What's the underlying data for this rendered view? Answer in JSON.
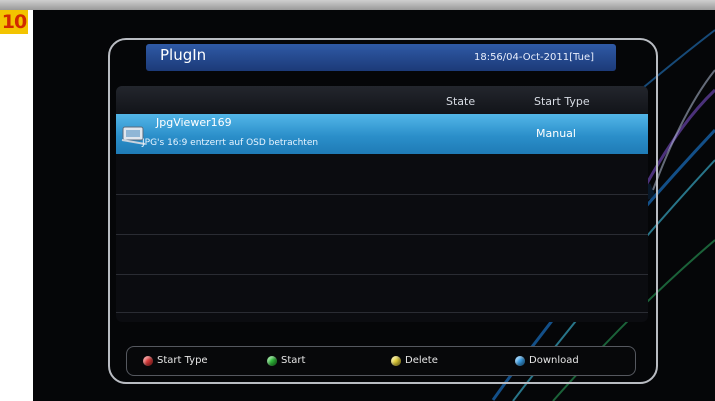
{
  "badge": "10",
  "header": {
    "title": "PlugIn",
    "datetime": "18:56/04-Oct-2011[Tue]"
  },
  "table": {
    "columns": [
      "State",
      "Start Type"
    ],
    "rows": [
      {
        "name": "JpgViewer169",
        "description": "JPG's 16:9 entzerrt auf OSD betrachten",
        "state": "",
        "start_type": "Manual",
        "icon": "plugin-icon"
      }
    ]
  },
  "footer": {
    "keys": [
      {
        "label": "Start Type",
        "color": "#e23a3a",
        "icon": "red-key-icon"
      },
      {
        "label": "Start",
        "color": "#2fbf3a",
        "icon": "green-key-icon"
      },
      {
        "label": "Delete",
        "color": "#e8d43a",
        "icon": "yellow-key-icon"
      },
      {
        "label": "Download",
        "color": "#3aa2ec",
        "icon": "blue-key-icon"
      }
    ]
  },
  "colors": {
    "accent": "#2b8fca",
    "title_bar": "#2f5aa6",
    "background": "#050608"
  }
}
